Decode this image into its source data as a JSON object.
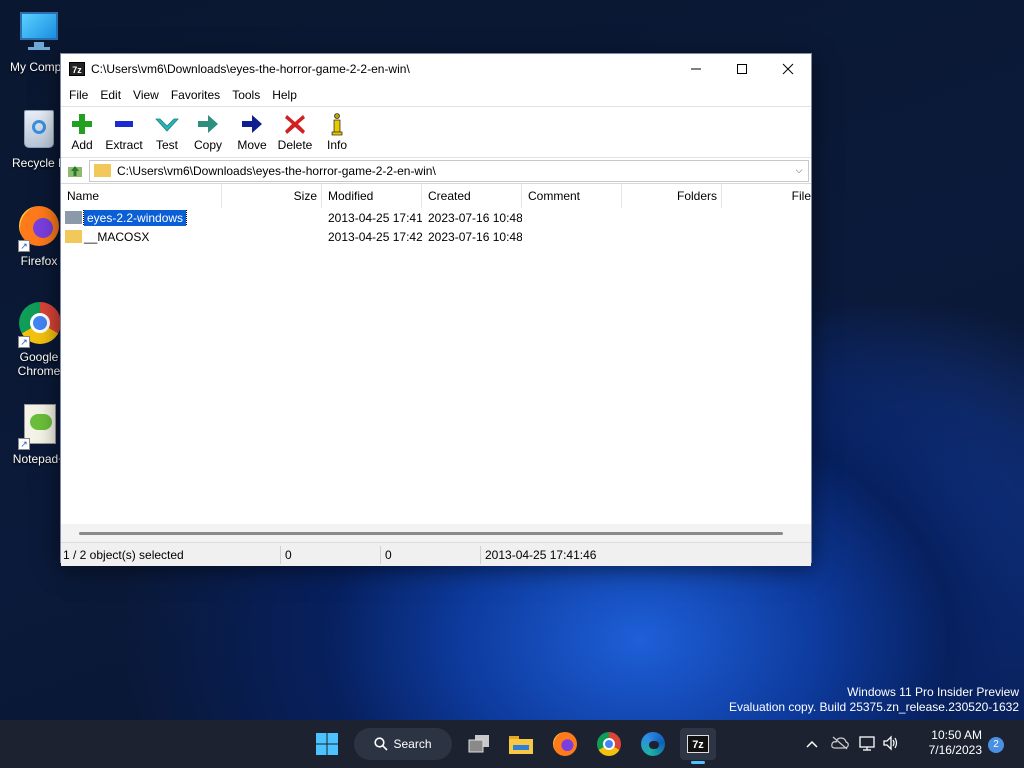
{
  "desktop": {
    "icons": [
      {
        "label": "My Compu"
      },
      {
        "label": "Recycle B"
      },
      {
        "label": "Firefox"
      },
      {
        "label": "Google Chrome"
      },
      {
        "label": "Notepad+"
      }
    ],
    "watermark": {
      "line1": "Windows 11 Pro Insider Preview",
      "line2": "Evaluation copy. Build 25375.zn_release.230520-1632"
    }
  },
  "window": {
    "app_icon": "7z",
    "title": "C:\\Users\\vm6\\Downloads\\eyes-the-horror-game-2-2-en-win\\",
    "menu": [
      "File",
      "Edit",
      "View",
      "Favorites",
      "Tools",
      "Help"
    ],
    "toolbar": [
      {
        "label": "Add",
        "icon": "plus-icon",
        "color": "#22a022"
      },
      {
        "label": "Extract",
        "icon": "minus-icon",
        "color": "#1a2bd0"
      },
      {
        "label": "Test",
        "icon": "check-icon",
        "color": "#27b5b5"
      },
      {
        "label": "Copy",
        "icon": "copy-arrow-icon",
        "color": "#2f8f7f"
      },
      {
        "label": "Move",
        "icon": "move-arrow-icon",
        "color": "#0f1f8f"
      },
      {
        "label": "Delete",
        "icon": "delete-x-icon",
        "color": "#d02020"
      },
      {
        "label": "Info",
        "icon": "info-icon",
        "color": "#c0a000"
      }
    ],
    "address": "C:\\Users\\vm6\\Downloads\\eyes-the-horror-game-2-2-en-win\\",
    "columns": [
      "Name",
      "Size",
      "Modified",
      "Created",
      "Comment",
      "Folders",
      "File"
    ],
    "rows": [
      {
        "name": "eyes-2.2-windows",
        "size": "",
        "modified": "2013-04-25 17:41",
        "created": "2023-07-16 10:48",
        "selected": true
      },
      {
        "name": "__MACOSX",
        "size": "",
        "modified": "2013-04-25 17:42",
        "created": "2023-07-16 10:48",
        "selected": false
      }
    ],
    "status": {
      "selection": "1 / 2 object(s) selected",
      "size": "0",
      "packed": "0",
      "datetime": "2013-04-25 17:41:46"
    }
  },
  "taskbar": {
    "search_label": "Search",
    "time": "10:50 AM",
    "date": "7/16/2023",
    "notifications": "2",
    "active_app": "7z"
  },
  "colors": {
    "selection": "#0a5fd6",
    "folder": "#f2c85b",
    "taskbar": "#1c2230"
  }
}
